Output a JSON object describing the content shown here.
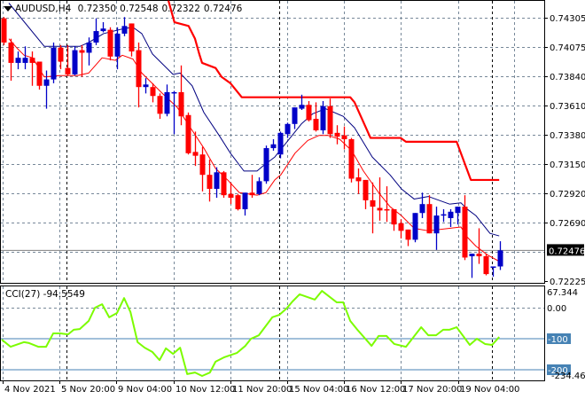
{
  "header": {
    "symbol": "AUDUSD,H4",
    "open": "0.72350",
    "high": "0.72548",
    "low": "0.72322",
    "close": "0.72476"
  },
  "indicator": {
    "name": "CCI(27)",
    "value": "-94.5549"
  },
  "colors": {
    "bull": "#0000c8",
    "bear": "#ff0000",
    "ma_fast": "#000080",
    "ma_slow": "#ff0000",
    "stop_line": "#ff0000",
    "cci_line": "#7cfc00",
    "level_line": "#4682b4",
    "grid": "#778899"
  },
  "chart_data": [
    {
      "type": "candlestick",
      "title": "AUDUSD,H4",
      "ylim": [
        0.72225,
        0.74305
      ],
      "price_ticks": [
        "0.74305",
        "0.74075",
        "0.73840",
        "0.73610",
        "0.73380",
        "0.73150",
        "0.72920",
        "0.72690",
        "0.72225"
      ],
      "current_price_label": "0.72476",
      "time_ticks": [
        "4 Nov 2021",
        "5 Nov 20:00",
        "9 Nov 04:00",
        "10 Nov 12:00",
        "11 Nov 20:00",
        "15 Nov 04:00",
        "16 Nov 12:00",
        "17 Nov 20:00",
        "19 Nov 04:00"
      ],
      "ohlc": [
        [
          0.743,
          0.7431,
          0.7409,
          0.7411
        ],
        [
          0.7411,
          0.7414,
          0.7381,
          0.7395
        ],
        [
          0.7395,
          0.7404,
          0.739,
          0.7399
        ],
        [
          0.7395,
          0.7408,
          0.739,
          0.7399
        ],
        [
          0.7399,
          0.7404,
          0.7377,
          0.7395
        ],
        [
          0.7396,
          0.7396,
          0.7374,
          0.7377
        ],
        [
          0.7377,
          0.7389,
          0.7359,
          0.7382
        ],
        [
          0.7382,
          0.7411,
          0.7379,
          0.7407
        ],
        [
          0.7407,
          0.7409,
          0.739,
          0.7396
        ],
        [
          0.7391,
          0.7409,
          0.7385,
          0.7386
        ],
        [
          0.7386,
          0.7408,
          0.7385,
          0.7405
        ],
        [
          0.7405,
          0.7409,
          0.7384,
          0.7403
        ],
        [
          0.7403,
          0.7415,
          0.7393,
          0.7411
        ],
        [
          0.7411,
          0.743,
          0.7409,
          0.742
        ],
        [
          0.742,
          0.7427,
          0.7419,
          0.7422
        ],
        [
          0.7421,
          0.7423,
          0.7397,
          0.74
        ],
        [
          0.74,
          0.7423,
          0.739,
          0.7418
        ],
        [
          0.7418,
          0.7431,
          0.7416,
          0.7424
        ],
        [
          0.7426,
          0.7426,
          0.74,
          0.7404
        ],
        [
          0.7405,
          0.7411,
          0.736,
          0.7376
        ],
        [
          0.7376,
          0.7383,
          0.7371,
          0.7378
        ],
        [
          0.7376,
          0.7379,
          0.7364,
          0.7369
        ],
        [
          0.7369,
          0.7371,
          0.7351,
          0.7355
        ],
        [
          0.7355,
          0.7378,
          0.7353,
          0.7372
        ],
        [
          0.7372,
          0.7373,
          0.7339,
          0.7372
        ],
        [
          0.7372,
          0.7393,
          0.7346,
          0.7353
        ],
        [
          0.7354,
          0.7356,
          0.7323,
          0.7324
        ],
        [
          0.7325,
          0.7341,
          0.7314,
          0.7322
        ],
        [
          0.7323,
          0.7329,
          0.7294,
          0.7307
        ],
        [
          0.7307,
          0.7319,
          0.7286,
          0.7296
        ],
        [
          0.7296,
          0.7313,
          0.7289,
          0.7309
        ],
        [
          0.7309,
          0.731,
          0.7289,
          0.7291
        ],
        [
          0.7292,
          0.7301,
          0.7284,
          0.7289
        ],
        [
          0.7291,
          0.7292,
          0.7279,
          0.728
        ],
        [
          0.728,
          0.7293,
          0.7275,
          0.7293
        ],
        [
          0.7293,
          0.7307,
          0.7289,
          0.7291
        ],
        [
          0.7292,
          0.7305,
          0.7291,
          0.7302
        ],
        [
          0.7302,
          0.733,
          0.73,
          0.7328
        ],
        [
          0.7328,
          0.7335,
          0.7326,
          0.7331
        ],
        [
          0.7323,
          0.7341,
          0.732,
          0.734
        ],
        [
          0.7339,
          0.7348,
          0.7336,
          0.7347
        ],
        [
          0.7347,
          0.736,
          0.7343,
          0.736
        ],
        [
          0.7359,
          0.737,
          0.7358,
          0.7362
        ],
        [
          0.7362,
          0.7365,
          0.7349,
          0.735
        ],
        [
          0.7351,
          0.7364,
          0.7341,
          0.7342
        ],
        [
          0.7342,
          0.7365,
          0.7339,
          0.7361
        ],
        [
          0.7361,
          0.7367,
          0.7336,
          0.7339
        ],
        [
          0.734,
          0.7346,
          0.7331,
          0.7337
        ],
        [
          0.7338,
          0.7345,
          0.7327,
          0.7335
        ],
        [
          0.7335,
          0.7336,
          0.7301,
          0.7304
        ],
        [
          0.7305,
          0.7312,
          0.7292,
          0.7302
        ],
        [
          0.7303,
          0.7303,
          0.728,
          0.7287
        ],
        [
          0.7287,
          0.7301,
          0.7261,
          0.7282
        ],
        [
          0.7281,
          0.7305,
          0.7271,
          0.7279
        ],
        [
          0.728,
          0.7298,
          0.727,
          0.7279
        ],
        [
          0.728,
          0.728,
          0.7263,
          0.7268
        ],
        [
          0.7269,
          0.7272,
          0.7257,
          0.7263
        ],
        [
          0.7264,
          0.7264,
          0.7251,
          0.7256
        ],
        [
          0.7256,
          0.7277,
          0.7254,
          0.7277
        ],
        [
          0.7277,
          0.7293,
          0.7273,
          0.7284
        ],
        [
          0.7284,
          0.7291,
          0.7261,
          0.7261
        ],
        [
          0.7261,
          0.7282,
          0.7248,
          0.7275
        ],
        [
          0.7275,
          0.728,
          0.727,
          0.7276
        ],
        [
          0.7273,
          0.728,
          0.7266,
          0.7278
        ],
        [
          0.7277,
          0.7282,
          0.7268,
          0.7282
        ],
        [
          0.7282,
          0.7291,
          0.724,
          0.7242
        ],
        [
          0.7243,
          0.7245,
          0.7226,
          0.7245
        ],
        [
          0.7245,
          0.7265,
          0.7237,
          0.7243
        ],
        [
          0.7243,
          0.7245,
          0.7228,
          0.7229
        ],
        [
          0.7234,
          0.7235,
          0.7227,
          0.7235
        ],
        [
          0.7235,
          0.72548,
          0.72322,
          0.72476
        ]
      ],
      "series": [
        {
          "name": "ma_fast",
          "points": [
            [
              0.75,
              0.7442
            ],
            [
              5.75,
              0.7408
            ],
            [
              10.75,
              0.7408
            ],
            [
              12,
              0.7411
            ],
            [
              14.1,
              0.7418
            ],
            [
              17,
              0.7422
            ],
            [
              18.25,
              0.7423
            ],
            [
              19.5,
              0.7418
            ],
            [
              21,
              0.7402
            ],
            [
              23.9,
              0.7386
            ],
            [
              24.9,
              0.7387
            ],
            [
              26.6,
              0.7377
            ],
            [
              28.25,
              0.7356
            ],
            [
              30.4,
              0.7338
            ],
            [
              32,
              0.7324
            ],
            [
              33.9,
              0.731
            ],
            [
              35.75,
              0.731
            ],
            [
              36.6,
              0.7314
            ],
            [
              38.25,
              0.7321
            ],
            [
              42,
              0.7347
            ],
            [
              43.6,
              0.7355
            ],
            [
              45.4,
              0.7359
            ],
            [
              47.9,
              0.7353
            ],
            [
              49.5,
              0.7344
            ],
            [
              52,
              0.7321
            ],
            [
              54.5,
              0.7307
            ],
            [
              56.1,
              0.7296
            ],
            [
              57.9,
              0.7288
            ],
            [
              59.9,
              0.729
            ],
            [
              62.9,
              0.7284
            ],
            [
              64.5,
              0.7285
            ],
            [
              65.4,
              0.728
            ],
            [
              66.6,
              0.7275
            ],
            [
              68.6,
              0.7261
            ],
            [
              69.9,
              0.7259
            ]
          ]
        },
        {
          "name": "ma_slow",
          "points": [
            [
              0.75,
              0.7414
            ],
            [
              2,
              0.7406
            ],
            [
              2.9,
              0.7401
            ],
            [
              4.1,
              0.7399
            ],
            [
              5.75,
              0.7384
            ],
            [
              7.9,
              0.7385
            ],
            [
              10.4,
              0.7385
            ],
            [
              12,
              0.7387
            ],
            [
              13.9,
              0.7399
            ],
            [
              15.75,
              0.7397
            ],
            [
              16.75,
              0.7401
            ],
            [
              18.25,
              0.7398
            ],
            [
              19.5,
              0.7387
            ],
            [
              22.4,
              0.7371
            ],
            [
              24.5,
              0.736
            ],
            [
              26.6,
              0.7342
            ],
            [
              28.25,
              0.7328
            ],
            [
              29.9,
              0.7312
            ],
            [
              31.6,
              0.7303
            ],
            [
              33.25,
              0.7293
            ],
            [
              35.75,
              0.7291
            ],
            [
              37,
              0.7293
            ],
            [
              38.25,
              0.7303
            ],
            [
              39.1,
              0.7307
            ],
            [
              41.1,
              0.7324
            ],
            [
              42.9,
              0.7334
            ],
            [
              44.5,
              0.7338
            ],
            [
              45.75,
              0.7338
            ],
            [
              47.4,
              0.7335
            ],
            [
              49.1,
              0.7326
            ],
            [
              50.75,
              0.731
            ],
            [
              52.9,
              0.7293
            ],
            [
              54.5,
              0.7282
            ],
            [
              56.1,
              0.7275
            ],
            [
              57.9,
              0.7265
            ],
            [
              59.9,
              0.7263
            ],
            [
              62.9,
              0.7265
            ],
            [
              64.5,
              0.7266
            ],
            [
              65.4,
              0.7258
            ],
            [
              66.6,
              0.7251
            ],
            [
              68.25,
              0.7244
            ],
            [
              69.9,
              0.7239
            ]
          ]
        },
        {
          "name": "stop_line",
          "points": [
            [
              23.25,
              0.7444
            ],
            [
              24.1,
              0.7427
            ],
            [
              26.1,
              0.7424
            ],
            [
              27,
              0.7414
            ],
            [
              27.6,
              0.7402
            ],
            [
              28,
              0.7395
            ],
            [
              29.9,
              0.7391
            ],
            [
              30.75,
              0.7384
            ],
            [
              32,
              0.7379
            ],
            [
              33.6,
              0.7368
            ],
            [
              48.9,
              0.7368
            ],
            [
              49.5,
              0.7364
            ],
            [
              51.75,
              0.7336
            ],
            [
              56,
              0.7336
            ],
            [
              56.75,
              0.7333
            ],
            [
              63.9,
              0.7333
            ],
            [
              65.9,
              0.7303
            ],
            [
              69.9,
              0.7303
            ]
          ]
        }
      ]
    },
    {
      "type": "line",
      "title": "CCI(27)",
      "ylim": [
        -234.4616,
        67.344
      ],
      "tick_labels": {
        "max": "67.344",
        "zero": "0.00",
        "min": "-234.4616"
      },
      "levels": [
        {
          "value": -100,
          "label": "-100"
        },
        {
          "value": -200,
          "label": "-200"
        }
      ],
      "points": [
        [
          -0.25,
          -103
        ],
        [
          1,
          -126
        ],
        [
          2.9,
          -111
        ],
        [
          3.6,
          -114
        ],
        [
          4.9,
          -126
        ],
        [
          6,
          -126
        ],
        [
          7,
          -83
        ],
        [
          8,
          -83
        ],
        [
          9.1,
          -86
        ],
        [
          9.9,
          -71
        ],
        [
          10.75,
          -69
        ],
        [
          12,
          -43
        ],
        [
          12.9,
          0
        ],
        [
          13.9,
          11
        ],
        [
          14.9,
          -31
        ],
        [
          16,
          -17
        ],
        [
          17,
          31
        ],
        [
          17.9,
          -14
        ],
        [
          18.9,
          -111
        ],
        [
          19.9,
          -129
        ],
        [
          21,
          -143
        ],
        [
          22,
          -169
        ],
        [
          22.9,
          -131
        ],
        [
          23.9,
          -149
        ],
        [
          24.9,
          -129
        ],
        [
          25.9,
          -214
        ],
        [
          27,
          -209
        ],
        [
          28,
          -220
        ],
        [
          29.1,
          -209
        ],
        [
          29.9,
          -174
        ],
        [
          31.1,
          -160
        ],
        [
          32.9,
          -146
        ],
        [
          34.1,
          -123
        ],
        [
          34.9,
          -100
        ],
        [
          36,
          -89
        ],
        [
          37.9,
          -31
        ],
        [
          38.9,
          -23
        ],
        [
          39.9,
          -3
        ],
        [
          40.75,
          20
        ],
        [
          41.75,
          43
        ],
        [
          43.9,
          26
        ],
        [
          44.9,
          54
        ],
        [
          47,
          17
        ],
        [
          47.9,
          17
        ],
        [
          48.9,
          -43
        ],
        [
          49.9,
          -71
        ],
        [
          51.9,
          -123
        ],
        [
          52.9,
          -91
        ],
        [
          54,
          -91
        ],
        [
          55.1,
          -117
        ],
        [
          56.75,
          -126
        ],
        [
          58.9,
          -63
        ],
        [
          59.9,
          -89
        ],
        [
          61,
          -89
        ],
        [
          62,
          -71
        ],
        [
          62.9,
          -71
        ],
        [
          63.9,
          -63
        ],
        [
          65.75,
          -120
        ],
        [
          66.75,
          -100
        ],
        [
          67.9,
          -117
        ],
        [
          68.9,
          -120
        ],
        [
          69.9,
          -94.5549
        ]
      ]
    }
  ]
}
